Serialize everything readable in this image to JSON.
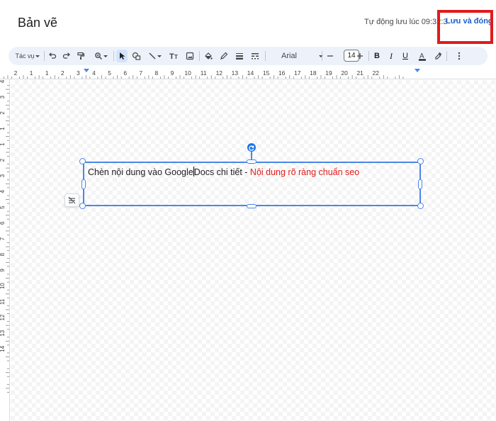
{
  "header": {
    "title": "Bản vẽ",
    "autosave": "Tự động lưu lúc 09:32:3",
    "save_close": "Lưu và đóng"
  },
  "toolbar": {
    "actions_label": "Tác vụ",
    "font_name": "Arial",
    "font_size": "14",
    "icons": [
      "undo-icon",
      "redo-icon",
      "paint-format-icon",
      "zoom-icon",
      "select-icon",
      "shape-icon",
      "line-icon",
      "text-box-icon",
      "image-icon",
      "fill-color-icon",
      "border-color-icon",
      "border-weight-icon",
      "border-dash-icon",
      "font-dropdown",
      "decrease-size-icon",
      "increase-size-icon",
      "bold-icon",
      "italic-icon",
      "underline-icon",
      "text-color-icon",
      "highlight-icon",
      "more-icon"
    ]
  },
  "ruler": {
    "h_labels": [
      "2",
      "1",
      "1",
      "2",
      "3",
      "4",
      "5",
      "6",
      "7",
      "8",
      "9",
      "10",
      "11",
      "12",
      "13",
      "14",
      "15",
      "16",
      "17",
      "18",
      "19",
      "20",
      "21",
      "22"
    ],
    "v_labels": [
      "4",
      "3",
      "2",
      "1",
      "1",
      "2",
      "3",
      "4",
      "5",
      "6",
      "7",
      "8",
      "9",
      "10",
      "11",
      "12",
      "13",
      "14"
    ]
  },
  "canvas": {
    "text_part1": "Chèn nội dung vào Google",
    "text_part2": "Docs chi tiết - ",
    "text_red": "Nội dung rõ ràng chuẩn seo"
  },
  "colors": {
    "accent": "#1a5fcf",
    "selection": "#4a86e8",
    "highlight": "#e01b1b",
    "toolbar_bg": "#edf2fa"
  }
}
